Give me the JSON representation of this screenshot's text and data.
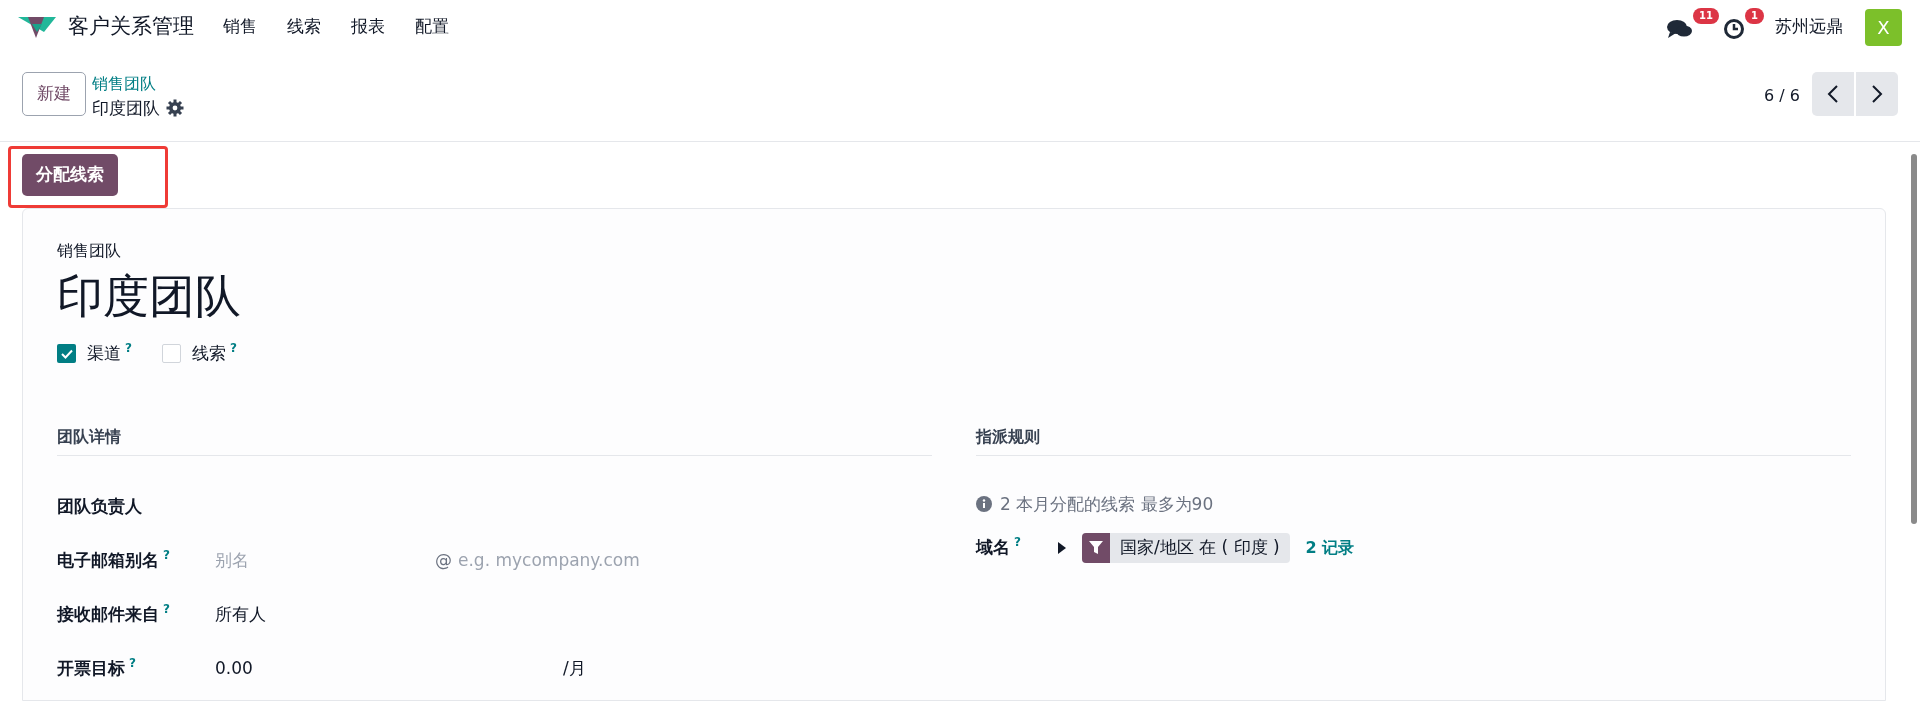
{
  "app": {
    "title": "客户关系管理",
    "menu": [
      "销售",
      "线索",
      "报表",
      "配置"
    ]
  },
  "systray": {
    "messages_badge": "11",
    "activities_badge": "1",
    "company": "苏州远鼎",
    "avatar": "X"
  },
  "control_panel": {
    "new_button": "新建",
    "breadcrumb": "销售团队",
    "record": "印度团队",
    "pager": "6 / 6"
  },
  "action_button": {
    "label": "分配线索",
    "highlighted": true
  },
  "form": {
    "caption": "销售团队",
    "name": "印度团队",
    "options": [
      {
        "label": "渠道",
        "help": "?",
        "checked": true
      },
      {
        "label": "线索",
        "help": "?",
        "checked": false
      }
    ],
    "left_section": {
      "title": "团队详情",
      "fields": [
        {
          "kind": "plain",
          "label": "团队负责人"
        },
        {
          "kind": "alias",
          "label": "电子邮箱别名",
          "help": "?",
          "placeholder": "别名",
          "at": "@",
          "domain_placeholder": "e.g. mycompany.com"
        },
        {
          "kind": "text",
          "label": "接收邮件来自",
          "help": "?",
          "value": "所有人"
        },
        {
          "kind": "amount",
          "label": "开票目标",
          "help": "?",
          "value": "0.00",
          "suffix": "/月"
        }
      ]
    },
    "right_section": {
      "title": "指派规则",
      "info": "2 本月分配的线索 最多为90",
      "domain": {
        "label": "域名",
        "help": "?",
        "tag": "国家/地区 在 ( 印度 )",
        "link": "2 记录"
      }
    }
  }
}
